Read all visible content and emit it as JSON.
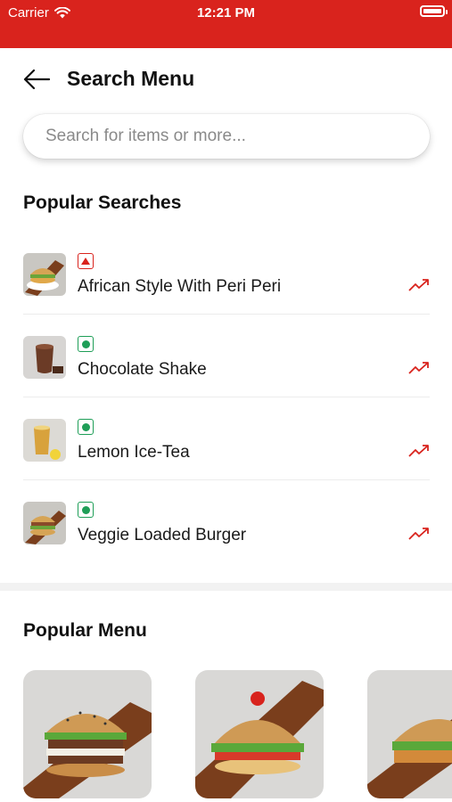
{
  "status_bar": {
    "carrier": "Carrier",
    "time": "12:21 PM",
    "background": "#d9231d"
  },
  "header": {
    "title": "Search Menu",
    "back_icon": "arrow-left-icon"
  },
  "search": {
    "placeholder": "Search for items or more...",
    "value": ""
  },
  "popular_searches": {
    "title": "Popular Searches",
    "items": [
      {
        "name": "African Style With Peri Peri",
        "diet": "non-veg",
        "thumb": "burger-thumb",
        "trend_icon": "trending-up-icon"
      },
      {
        "name": "Chocolate Shake",
        "diet": "veg",
        "thumb": "shake-thumb",
        "trend_icon": "trending-up-icon"
      },
      {
        "name": "Lemon Ice-Tea",
        "diet": "veg",
        "thumb": "ice-tea-thumb",
        "trend_icon": "trending-up-icon"
      },
      {
        "name": "Veggie Loaded Burger",
        "diet": "veg",
        "thumb": "burger-thumb",
        "trend_icon": "trending-up-icon"
      }
    ]
  },
  "popular_menu": {
    "title": "Popular Menu",
    "items": [
      {
        "image": "double-patty-burger-image"
      },
      {
        "image": "tomato-burger-image"
      },
      {
        "image": "crispy-burger-image"
      }
    ]
  },
  "colors": {
    "accent": "#d9231d",
    "veg": "#1e9e57",
    "non_veg": "#d9231d"
  }
}
